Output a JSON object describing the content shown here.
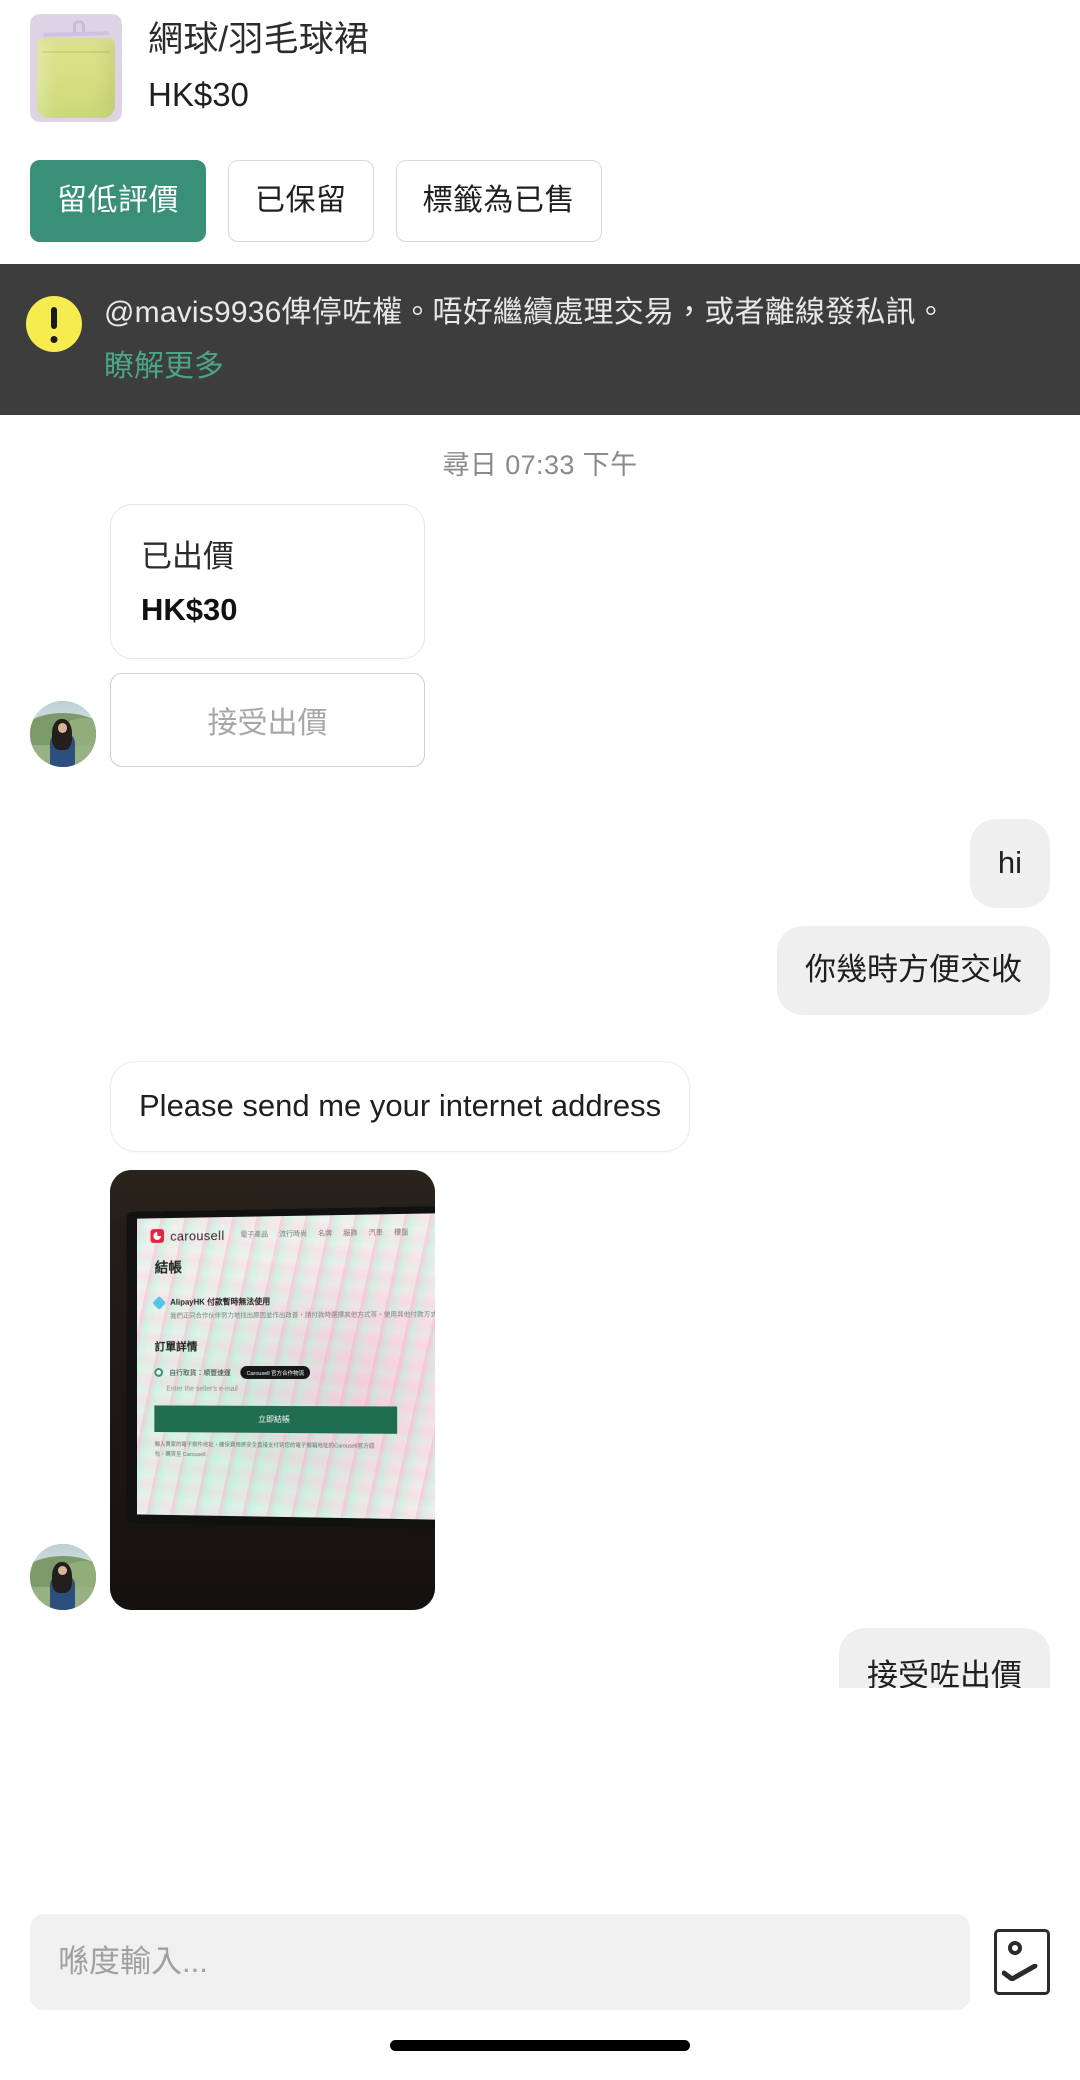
{
  "listing": {
    "title": "網球/羽毛球裙",
    "price": "HK$30",
    "thumbnail_alt": "yellow-green tennis skirt on hanger",
    "actions": [
      {
        "label": "留低評價",
        "style": "primary",
        "name": "leave-review-button"
      },
      {
        "label": "已保留",
        "style": "outline",
        "name": "reserved-button"
      },
      {
        "label": "標籤為已售",
        "style": "outline",
        "name": "mark-as-sold-button"
      }
    ]
  },
  "warning": {
    "icon": "exclamation-icon",
    "text": "@mavis9936俾停咗權。唔好繼續處理交易，或者離線發私訊。",
    "link_label": "瞭解更多",
    "background_color": "#3d3d3d",
    "icon_color": "#f6ec50",
    "link_color": "#4aa487"
  },
  "chat": {
    "timestamp": "尋日 07:33 下午",
    "offer": {
      "label": "已出價",
      "amount": "HK$30",
      "accept_label": "接受出價"
    },
    "messages": [
      {
        "id": "m1",
        "side": "right",
        "text": "hi"
      },
      {
        "id": "m2",
        "side": "right",
        "text": "你幾時方便交收"
      },
      {
        "id": "m3",
        "side": "left",
        "text": "Please send me your internet address"
      }
    ],
    "photo_message": {
      "alt": "photo of monitor showing Carousell checkout page",
      "content": {
        "brand": "carousell",
        "nav": [
          "電子產品",
          "流行時尚",
          "名牌",
          "服飾",
          "汽車",
          "樓盤"
        ],
        "heading": "結帳",
        "alert_title": "AlipayHK 付款暫時無法使用",
        "alert_sub": "我們正同合作伙伴努力地找出原因並作出改善，請付款時選擇其他方式等。使用其他付款方式",
        "section_title": "訂單詳情",
        "option_label": "自行取貨：順豐速運",
        "option_badge": "Carousell 官方合作物流",
        "input_placeholder": "Enter the seller's e-mail",
        "cta": "立即結帳",
        "fine_print": "輸入賣家的電子郵件地址，確保費用將安全直接支付到您的電子郵箱地址的Carousell官方錢包，購買至 Carousell"
      }
    },
    "clipped_message": {
      "side": "right",
      "text": "接受咗出價"
    }
  },
  "composer": {
    "placeholder": "喺度輸入...",
    "image_button_icon": "image-icon"
  },
  "colors": {
    "accent_green": "#3a9077",
    "banner_dark": "#3d3d3d",
    "bubble_out": "#efefef",
    "warning_yellow": "#f6ec50"
  }
}
